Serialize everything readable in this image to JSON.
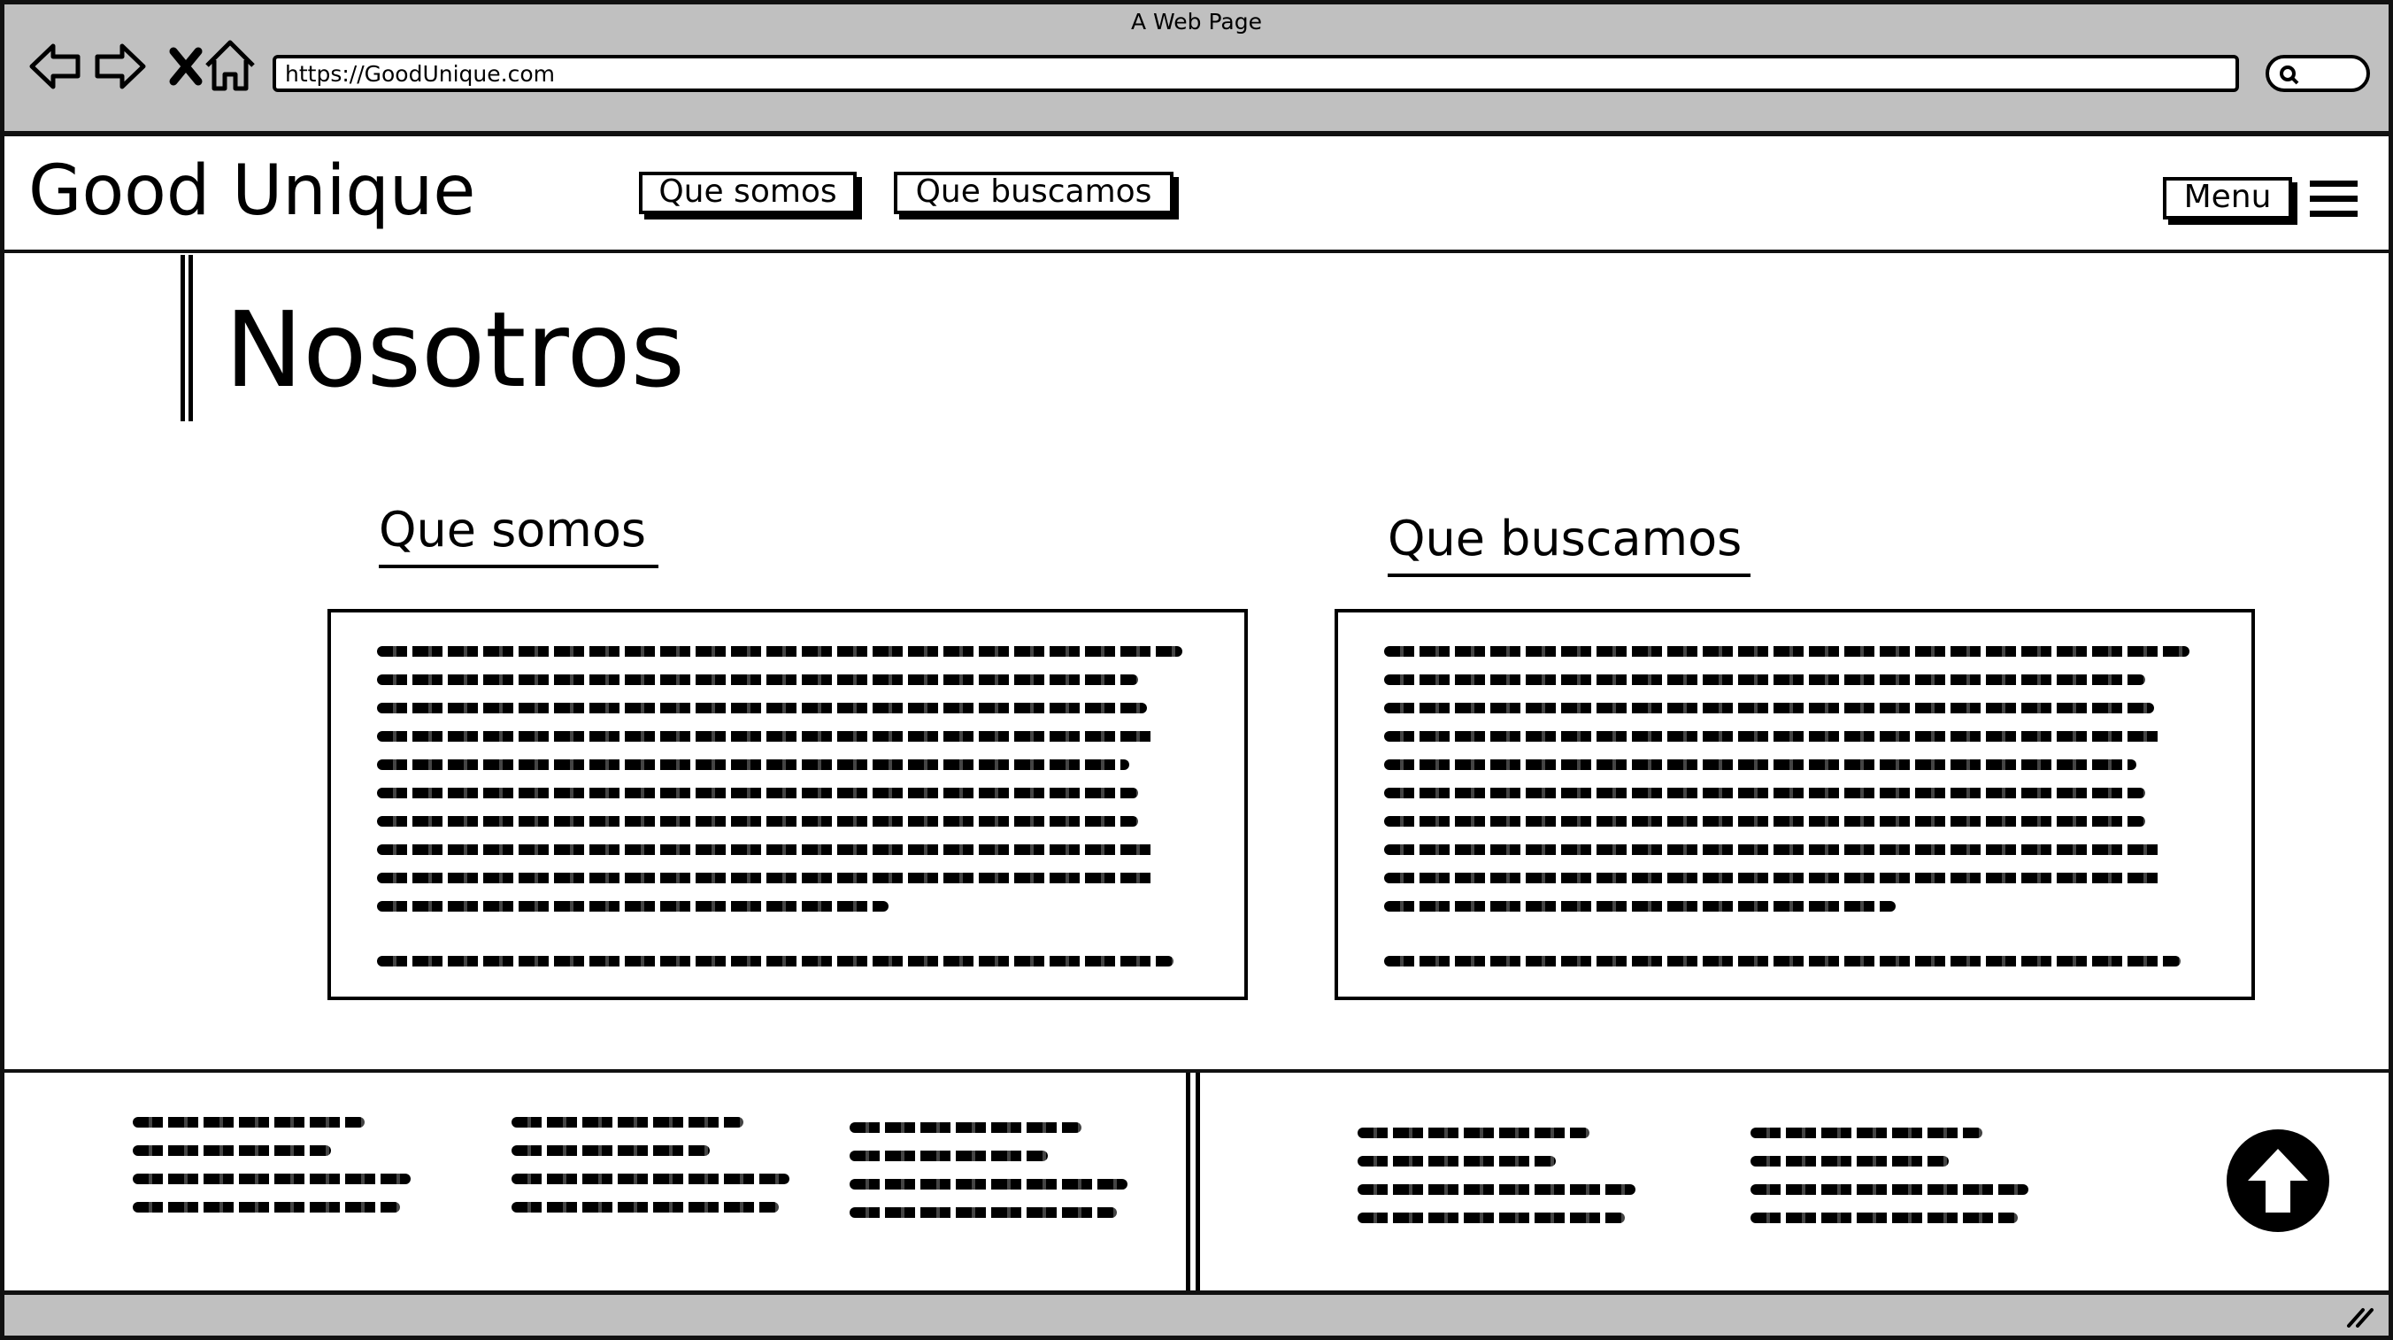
{
  "browser": {
    "window_title": "A Web Page",
    "url": "https://GoodUnique.com",
    "icons": [
      "back-arrow-icon",
      "forward-arrow-icon",
      "stop-icon",
      "home-icon",
      "search-icon"
    ]
  },
  "header": {
    "logo": "Good Unique",
    "nav": [
      "Que somos",
      "Que buscamos"
    ],
    "menu_label": "Menu",
    "menu_icon": "hamburger-icon"
  },
  "main": {
    "title": "Nosotros",
    "sections": [
      {
        "heading": "Que somos"
      },
      {
        "heading": "Que buscamos"
      }
    ]
  },
  "footer": {
    "scroll_top_icon": "arrow-up-icon"
  },
  "colors": {
    "chrome": "#c0c0c0",
    "ink": "#000000",
    "page": "#ffffff"
  }
}
